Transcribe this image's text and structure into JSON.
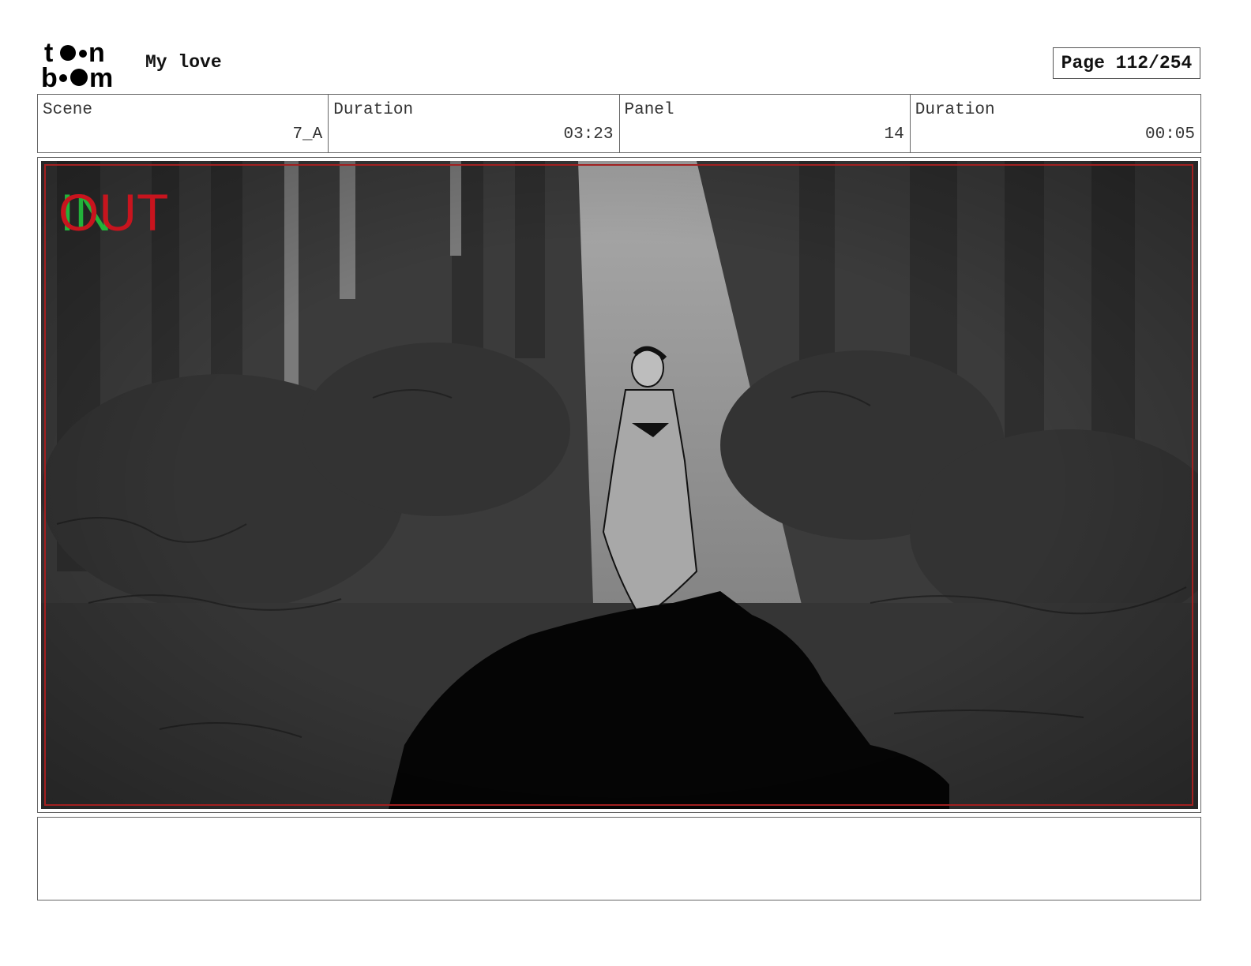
{
  "header": {
    "logo_text": "toon boom",
    "project_title": "My love",
    "page_label": "Page 112/254"
  },
  "info": {
    "scene_label": "Scene",
    "scene_value": "7_A",
    "scene_duration_label": "Duration",
    "scene_duration_value": "03:23",
    "panel_label": "Panel",
    "panel_value": "14",
    "panel_duration_label": "Duration",
    "panel_duration_value": "00:05"
  },
  "panel": {
    "in_marker": "IN",
    "out_marker": "OUT",
    "safe_frame_color": "#a12020",
    "in_color": "#22b33a",
    "out_color": "#c8141e"
  },
  "notes": {
    "text": ""
  }
}
